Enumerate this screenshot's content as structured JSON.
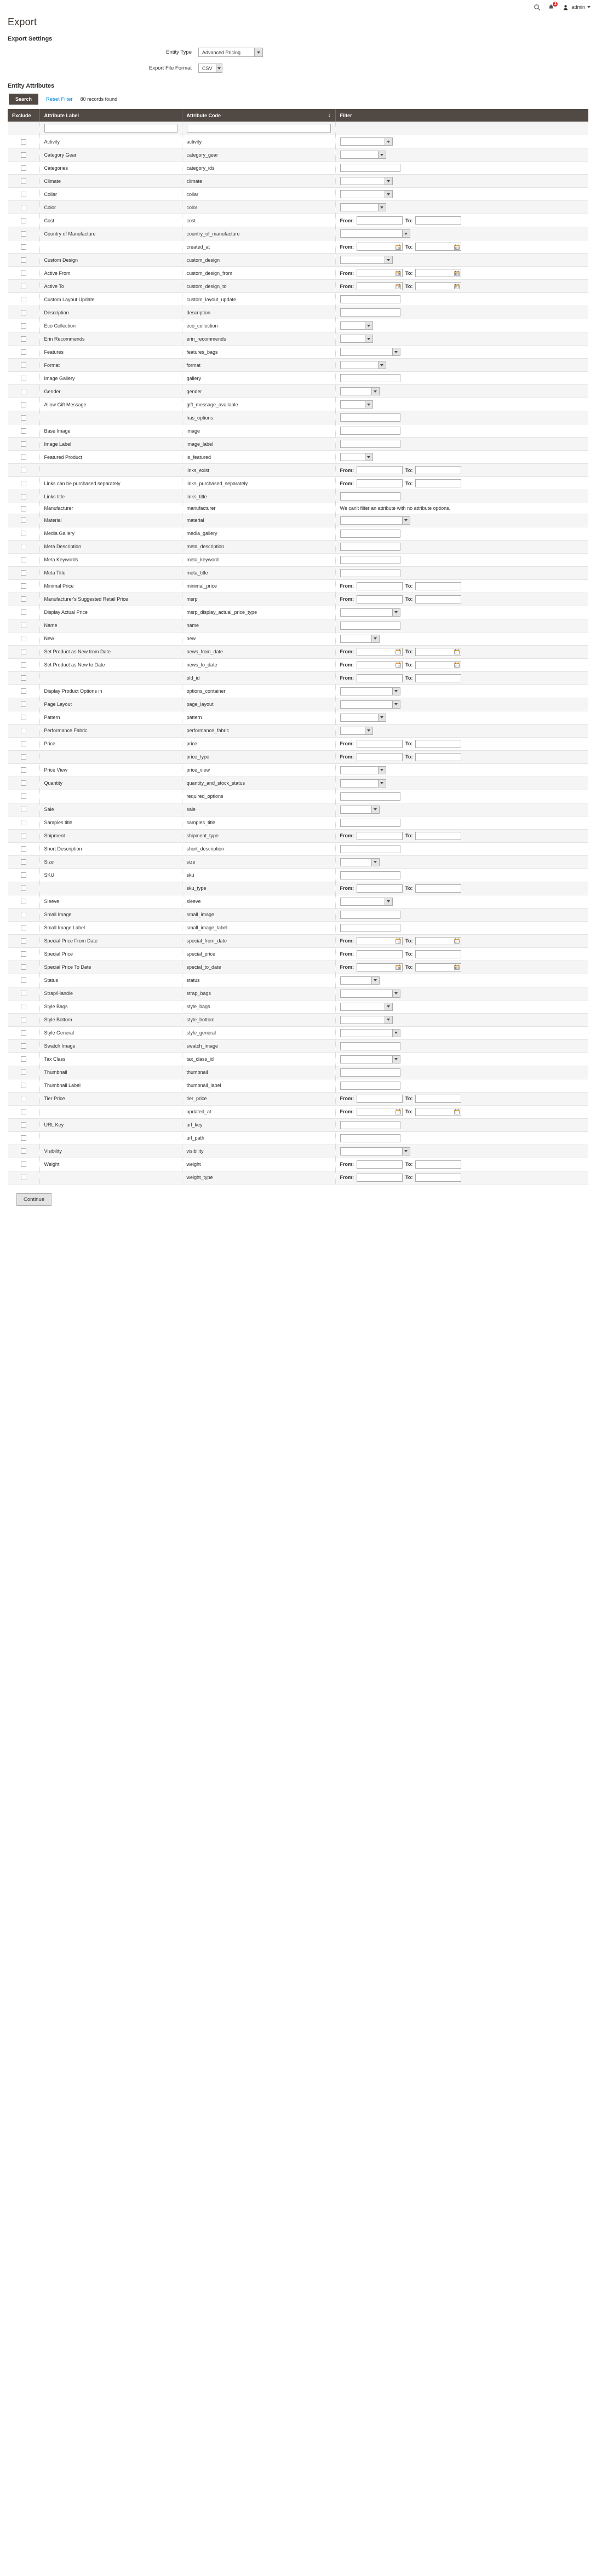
{
  "header": {
    "search_icon": "search-icon",
    "notifications_icon": "bell-icon",
    "notification_count": "2",
    "user_icon": "user-avatar-icon",
    "user_name": "admin"
  },
  "page": {
    "title": "Export"
  },
  "settings": {
    "section_title": "Export Settings",
    "entity_type_label": "Entity Type",
    "entity_type_value": "Advanced Pricing",
    "export_format_label": "Export File Format",
    "export_format_value": "CSV"
  },
  "attributes": {
    "section_title": "Entity Attributes",
    "search_button": "Search",
    "reset_filter_link": "Reset Filter",
    "records_found": "80 records found",
    "columns": {
      "exclude": "Exclude",
      "attribute_label": "Attribute Label",
      "attribute_code": "Attribute Code",
      "filter": "Filter"
    },
    "sort_indicator": "↓",
    "filter_row": {
      "label_value": "",
      "code_value": ""
    },
    "from_label": "From:",
    "to_label": "To:",
    "rows": [
      {
        "label": "Activity",
        "code": "activity",
        "filter": "select",
        "w": "s-w4"
      },
      {
        "label": "Category Gear",
        "code": "category_gear",
        "filter": "select",
        "w": "s-w3"
      },
      {
        "label": "Categories",
        "code": "category_ids",
        "filter": "text",
        "w": "t-w3"
      },
      {
        "label": "Climate",
        "code": "climate",
        "filter": "select",
        "w": "s-w4"
      },
      {
        "label": "Collar",
        "code": "collar",
        "filter": "select",
        "w": "s-w4"
      },
      {
        "label": "Color",
        "code": "color",
        "filter": "select",
        "w": "s-w3"
      },
      {
        "label": "Cost",
        "code": "cost",
        "filter": "range-text",
        "w": "t-w2"
      },
      {
        "label": "Country of Manufacture",
        "code": "country_of_manufacture",
        "filter": "select",
        "w": "s-w6"
      },
      {
        "label": "",
        "code": "created_at",
        "filter": "range-date",
        "w": "d-w1"
      },
      {
        "label": "Custom Design",
        "code": "custom_design",
        "filter": "select",
        "w": "s-w4"
      },
      {
        "label": "Active From",
        "code": "custom_design_from",
        "filter": "range-date",
        "w": "d-w1"
      },
      {
        "label": "Active To",
        "code": "custom_design_to",
        "filter": "range-date",
        "w": "d-w1"
      },
      {
        "label": "Custom Layout Update",
        "code": "custom_layout_update",
        "filter": "text",
        "w": "t-w3"
      },
      {
        "label": "Description",
        "code": "description",
        "filter": "text",
        "w": "t-w3"
      },
      {
        "label": "Eco Collection",
        "code": "eco_collection",
        "filter": "select",
        "w": "s-w1"
      },
      {
        "label": "Erin Recommends",
        "code": "erin_recommends",
        "filter": "select",
        "w": "s-w1"
      },
      {
        "label": "Features",
        "code": "features_bags",
        "filter": "select",
        "w": "s-w5"
      },
      {
        "label": "Format",
        "code": "format",
        "filter": "select",
        "w": "s-w3"
      },
      {
        "label": "Image Gallery",
        "code": "gallery",
        "filter": "text",
        "w": "t-w3"
      },
      {
        "label": "Gender",
        "code": "gender",
        "filter": "select",
        "w": "s-w2"
      },
      {
        "label": "Allow Gift Message",
        "code": "gift_message_available",
        "filter": "select",
        "w": "s-w1"
      },
      {
        "label": "",
        "code": "has_options",
        "filter": "text",
        "w": "t-w3"
      },
      {
        "label": "Base Image",
        "code": "image",
        "filter": "text",
        "w": "t-w3"
      },
      {
        "label": "Image Label",
        "code": "image_label",
        "filter": "text",
        "w": "t-w3"
      },
      {
        "label": "Featured Product",
        "code": "is_featured",
        "filter": "select",
        "w": "s-w1"
      },
      {
        "label": "",
        "code": "links_exist",
        "filter": "range-text",
        "w": "t-w2"
      },
      {
        "label": "Links can be purchased separately",
        "code": "links_purchased_separately",
        "filter": "range-text",
        "w": "t-w2"
      },
      {
        "label": "Links title",
        "code": "links_title",
        "filter": "text",
        "w": "t-w3"
      },
      {
        "label": "Manufacturer",
        "code": "manufacturer",
        "filter": "note",
        "note": "We can't filter an attribute with no attribute options."
      },
      {
        "label": "Material",
        "code": "material",
        "filter": "select",
        "w": "s-w6"
      },
      {
        "label": "Media Gallery",
        "code": "media_gallery",
        "filter": "text",
        "w": "t-w3"
      },
      {
        "label": "Meta Description",
        "code": "meta_description",
        "filter": "text",
        "w": "t-w3"
      },
      {
        "label": "Meta Keywords",
        "code": "meta_keyword",
        "filter": "text",
        "w": "t-w3"
      },
      {
        "label": "Meta Title",
        "code": "meta_title",
        "filter": "text",
        "w": "t-w3"
      },
      {
        "label": "Minimal Price",
        "code": "minimal_price",
        "filter": "range-text",
        "w": "t-w2"
      },
      {
        "label": "Manufacturer's Suggested Retail Price",
        "code": "msrp",
        "filter": "range-text",
        "w": "t-w2"
      },
      {
        "label": "Display Actual Price",
        "code": "msrp_display_actual_price_type",
        "filter": "select",
        "w": "s-w5"
      },
      {
        "label": "Name",
        "code": "name",
        "filter": "text",
        "w": "t-w3"
      },
      {
        "label": "New",
        "code": "new",
        "filter": "select",
        "w": "s-w2"
      },
      {
        "label": "Set Product as New from Date",
        "code": "news_from_date",
        "filter": "range-date",
        "w": "d-w1"
      },
      {
        "label": "Set Product as New to Date",
        "code": "news_to_date",
        "filter": "range-date",
        "w": "d-w1"
      },
      {
        "label": "",
        "code": "old_id",
        "filter": "range-text",
        "w": "t-w2"
      },
      {
        "label": "Display Product Options in",
        "code": "options_container",
        "filter": "select",
        "w": "s-w5"
      },
      {
        "label": "Page Layout",
        "code": "page_layout",
        "filter": "select",
        "w": "s-w5"
      },
      {
        "label": "Pattern",
        "code": "pattern",
        "filter": "select",
        "w": "s-w3"
      },
      {
        "label": "Performance Fabric",
        "code": "performance_fabric",
        "filter": "select",
        "w": "s-w1"
      },
      {
        "label": "Price",
        "code": "price",
        "filter": "range-text",
        "w": "t-w2"
      },
      {
        "label": "",
        "code": "price_type",
        "filter": "range-text",
        "w": "t-w2"
      },
      {
        "label": "Price View",
        "code": "price_view",
        "filter": "select",
        "w": "s-w3"
      },
      {
        "label": "Quantity",
        "code": "quantity_and_stock_status",
        "filter": "select",
        "w": "s-w3"
      },
      {
        "label": "",
        "code": "required_options",
        "filter": "text",
        "w": "t-w3"
      },
      {
        "label": "Sale",
        "code": "sale",
        "filter": "select",
        "w": "s-w2"
      },
      {
        "label": "Samples title",
        "code": "samples_title",
        "filter": "text",
        "w": "t-w3"
      },
      {
        "label": "Shipment",
        "code": "shipment_type",
        "filter": "range-text",
        "w": "t-w2"
      },
      {
        "label": "Short Description",
        "code": "short_description",
        "filter": "text",
        "w": "t-w3"
      },
      {
        "label": "Size",
        "code": "size",
        "filter": "select",
        "w": "s-w2"
      },
      {
        "label": "SKU",
        "code": "sku",
        "filter": "text",
        "w": "t-w3"
      },
      {
        "label": "",
        "code": "sku_type",
        "filter": "range-text",
        "w": "t-w2"
      },
      {
        "label": "Sleeve",
        "code": "sleeve",
        "filter": "select",
        "w": "s-w4"
      },
      {
        "label": "Small Image",
        "code": "small_image",
        "filter": "text",
        "w": "t-w3"
      },
      {
        "label": "Small Image Label",
        "code": "small_image_label",
        "filter": "text",
        "w": "t-w3"
      },
      {
        "label": "Special Price From Date",
        "code": "special_from_date",
        "filter": "range-date",
        "w": "d-w1"
      },
      {
        "label": "Special Price",
        "code": "special_price",
        "filter": "range-text",
        "w": "t-w2"
      },
      {
        "label": "Special Price To Date",
        "code": "special_to_date",
        "filter": "range-date",
        "w": "d-w1"
      },
      {
        "label": "Status",
        "code": "status",
        "filter": "select",
        "w": "s-w2"
      },
      {
        "label": "Strap/Handle",
        "code": "strap_bags",
        "filter": "select",
        "w": "s-w5"
      },
      {
        "label": "Style Bags",
        "code": "style_bags",
        "filter": "select",
        "w": "s-w4"
      },
      {
        "label": "Style Bottom",
        "code": "style_bottom",
        "filter": "select",
        "w": "s-w4"
      },
      {
        "label": "Style General",
        "code": "style_general",
        "filter": "select",
        "w": "s-w5"
      },
      {
        "label": "Swatch Image",
        "code": "swatch_image",
        "filter": "text",
        "w": "t-w3"
      },
      {
        "label": "Tax Class",
        "code": "tax_class_id",
        "filter": "select",
        "w": "s-w5"
      },
      {
        "label": "Thumbnail",
        "code": "thumbnail",
        "filter": "text",
        "w": "t-w3"
      },
      {
        "label": "Thumbnail Label",
        "code": "thumbnail_label",
        "filter": "text",
        "w": "t-w3"
      },
      {
        "label": "Tier Price",
        "code": "tier_price",
        "filter": "range-text",
        "w": "t-w2"
      },
      {
        "label": "",
        "code": "updated_at",
        "filter": "range-date",
        "w": "d-w1"
      },
      {
        "label": "URL Key",
        "code": "url_key",
        "filter": "text",
        "w": "t-w3"
      },
      {
        "label": "",
        "code": "url_path",
        "filter": "text",
        "w": "t-w3"
      },
      {
        "label": "Visibility",
        "code": "visibility",
        "filter": "select",
        "w": "s-w6"
      },
      {
        "label": "Weight",
        "code": "weight",
        "filter": "range-text",
        "w": "t-w2"
      },
      {
        "label": "",
        "code": "weight_type",
        "filter": "range-text",
        "w": "t-w2"
      }
    ]
  },
  "footer": {
    "continue_button": "Continue"
  }
}
